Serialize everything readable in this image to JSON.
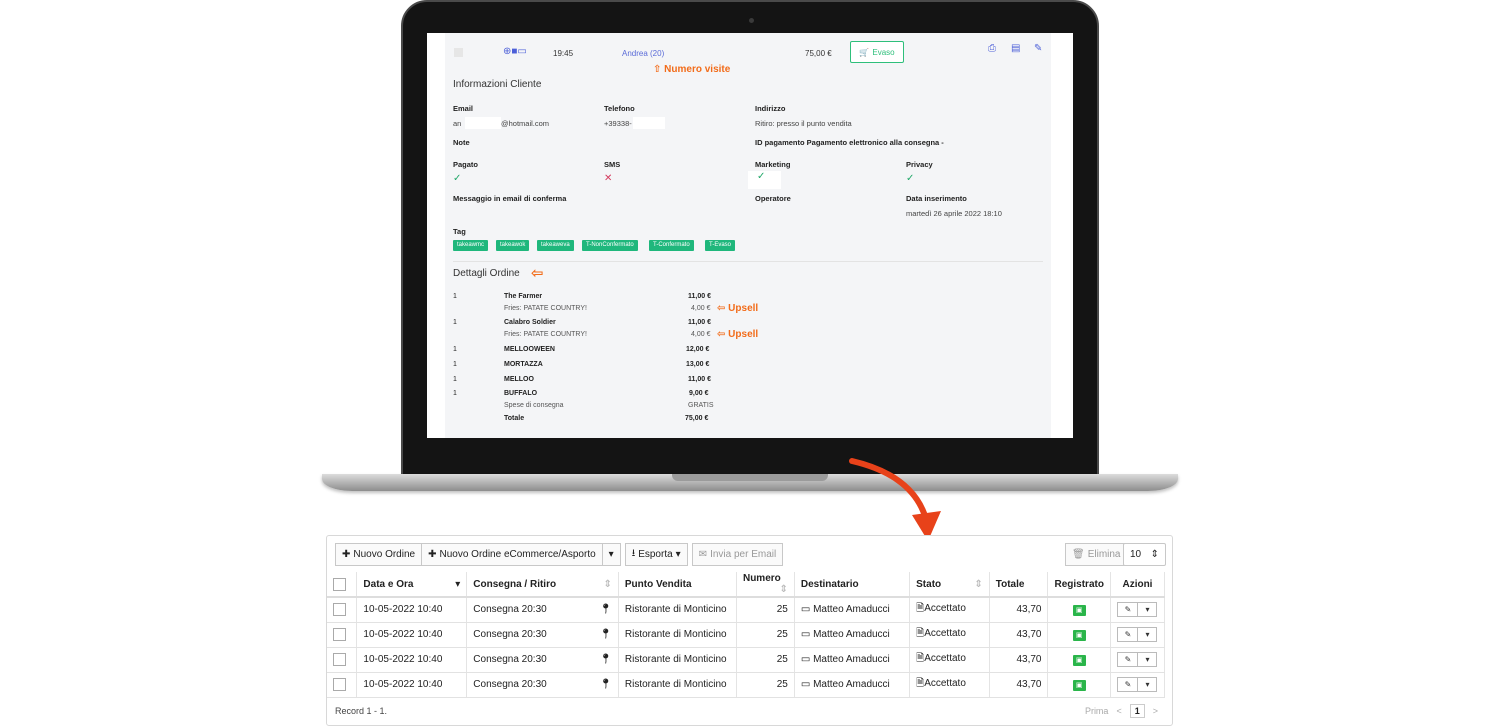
{
  "screen": {
    "header_row": {
      "time": "19:45",
      "customer": "Andrea (20)",
      "amount": "75,00 €",
      "status_button": "Evaso"
    },
    "annotation_visits": "Numero visite",
    "customer_info": {
      "title": "Informazioni Cliente",
      "email_label": "Email",
      "email_prefix": "an",
      "email_suffix": "@hotmail.com",
      "phone_label": "Telefono",
      "phone_value": "+39338-",
      "address_label": "Indirizzo",
      "address_value": "Ritiro: presso il punto vendita",
      "note_label": "Note",
      "payment_id_label": "ID pagamento Pagamento elettronico alla consegna -",
      "paid_label": "Pagato",
      "sms_label": "SMS",
      "marketing_label": "Marketing",
      "privacy_label": "Privacy",
      "confirm_msg_label": "Messaggio in email di conferma",
      "operator_label": "Operatore",
      "date_label": "Data inserimento",
      "date_value": "martedì 26 aprile 2022 18:10",
      "tag_label": "Tag",
      "tags": [
        "takeawmc",
        "takeawok",
        "takeaweva",
        "T-NonConfermato",
        "T-Confermato",
        "T-Evaso"
      ]
    },
    "order_details": {
      "title": "Dettagli Ordine",
      "items": [
        {
          "qty": "1",
          "name": "The Farmer",
          "price": "11,00 €",
          "sub": "Fries: PATATE COUNTRY!",
          "sub_price": "4,00 €",
          "note": "Upsell"
        },
        {
          "qty": "1",
          "name": "Calabro Soldier",
          "price": "11,00 €",
          "sub": "Fries: PATATE COUNTRY!",
          "sub_price": "4,00 €",
          "note": "Upsell"
        },
        {
          "qty": "1",
          "name": "MELLOOWEEN",
          "price": "12,00 €"
        },
        {
          "qty": "1",
          "name": "MORTAZZA",
          "price": "13,00 €"
        },
        {
          "qty": "1",
          "name": "MELLOO",
          "price": "11,00 €"
        },
        {
          "qty": "1",
          "name": "BUFFALO",
          "price": "9,00 €",
          "sub": "Spese di consegna",
          "sub_price": "GRATIS"
        }
      ],
      "total_label": "Totale",
      "total_value": "75,00 €"
    }
  },
  "table": {
    "toolbar": {
      "new_order": "Nuovo Ordine",
      "new_ecommerce": "Nuovo Ordine eCommerce/Asporto",
      "export": "Esporta",
      "send_email": "Invia per Email",
      "delete": "Elimina",
      "page_size": "10"
    },
    "headers": [
      "Data e Ora",
      "Consegna / Ritiro",
      "Punto Vendita",
      "Numero",
      "Destinatario",
      "Stato",
      "Totale",
      "Registrato",
      "Azioni"
    ],
    "rows": [
      {
        "date": "10-05-2022 10:40",
        "delivery": "Consegna 20:30",
        "store": "Ristorante di Monticino",
        "number": "25",
        "recipient": "Matteo Amaducci",
        "status": "Accettato",
        "total": "43,70"
      },
      {
        "date": "10-05-2022 10:40",
        "delivery": "Consegna 20:30",
        "store": "Ristorante di Monticino",
        "number": "25",
        "recipient": "Matteo Amaducci",
        "status": "Accettato",
        "total": "43,70"
      },
      {
        "date": "10-05-2022 10:40",
        "delivery": "Consegna 20:30",
        "store": "Ristorante di Monticino",
        "number": "25",
        "recipient": "Matteo Amaducci",
        "status": "Accettato",
        "total": "43,70"
      },
      {
        "date": "10-05-2022 10:40",
        "delivery": "Consegna 20:30",
        "store": "Ristorante di Monticino",
        "number": "25",
        "recipient": "Matteo Amaducci",
        "status": "Accettato",
        "total": "43,70"
      }
    ],
    "footer": {
      "records": "Record 1 - 1.",
      "first": "Prima",
      "prev": "<",
      "page": "1",
      "next": ">"
    }
  },
  "colors": {
    "accent_green": "#1fb77c",
    "annotation_orange": "#f26c1a",
    "link_blue": "#5a6bd8"
  }
}
